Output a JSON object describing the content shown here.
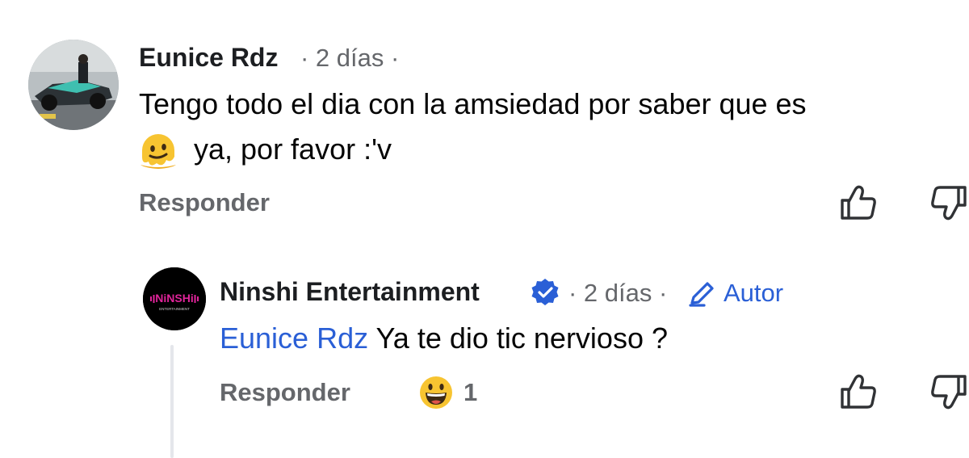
{
  "comment": {
    "author": "Eunice Rdz",
    "time": "· 2 días ·",
    "text_line1": "Tengo todo el dia con la amsiedad por saber que es",
    "emoji_icon": "melting-face-emoji",
    "text_line2": "ya, por favor :'v",
    "reply_label": "Responder"
  },
  "reply": {
    "author": "Ninshi Entertainment",
    "logo_text": "NiNSHi",
    "logo_subtext": "ENTERTAINMENT",
    "verified_icon": "verified-badge-icon",
    "time": "· 2 días ·",
    "author_badge": "Autor",
    "mention": "Eunice Rdz",
    "text": "Ya te dio tic nervioso ?",
    "reply_label": "Responder",
    "reaction_icon": "grinning-face-emoji",
    "reaction_count": "1"
  },
  "colors": {
    "link_blue": "#2a5fd6",
    "secondary_text": "#65676b",
    "logo_pink": "#e0249a"
  }
}
